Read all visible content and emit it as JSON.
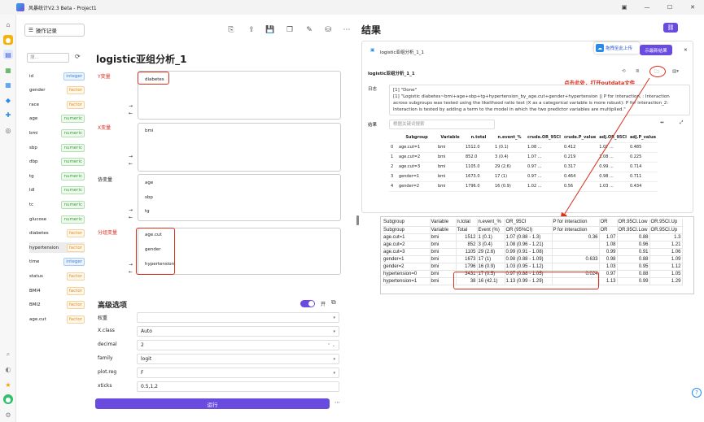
{
  "window": {
    "title": "风暴统计V2.3 Beta - Project1"
  },
  "toolbar": {
    "op_record": "操作记录"
  },
  "variables": {
    "search_placeholder": "搜...",
    "items": [
      {
        "name": "id",
        "type": "integer"
      },
      {
        "name": "gender",
        "type": "factor"
      },
      {
        "name": "race",
        "type": "factor"
      },
      {
        "name": "age",
        "type": "numeric"
      },
      {
        "name": "bmi",
        "type": "numeric"
      },
      {
        "name": "sbp",
        "type": "numeric"
      },
      {
        "name": "dbp",
        "type": "numeric"
      },
      {
        "name": "tg",
        "type": "numeric"
      },
      {
        "name": "ldl",
        "type": "numeric"
      },
      {
        "name": "tc",
        "type": "numeric"
      },
      {
        "name": "glucose",
        "type": "numeric"
      },
      {
        "name": "diabetes",
        "type": "factor"
      },
      {
        "name": "hypertension",
        "type": "factor"
      },
      {
        "name": "time",
        "type": "integer"
      },
      {
        "name": "status",
        "type": "factor"
      },
      {
        "name": "BMI4",
        "type": "factor"
      },
      {
        "name": "BMI2",
        "type": "factor"
      },
      {
        "name": "age.cut",
        "type": "factor"
      }
    ]
  },
  "analysis": {
    "title": "logistic亚组分析_1",
    "y_label": "Y变量",
    "y_items": [
      "diabetes"
    ],
    "x_label": "X变量",
    "x_items": [
      "bmi"
    ],
    "cov_label": "协变量",
    "cov_items": [
      "age",
      "sbp",
      "tg"
    ],
    "sub_label": "分组变量",
    "sub_items": [
      "age.cut",
      "gender",
      "hypertension"
    ]
  },
  "advanced": {
    "title": "高级选项",
    "toggle_label": "开",
    "fields": [
      {
        "label": "权重",
        "value": ""
      },
      {
        "label": "X.class",
        "value": "Auto"
      },
      {
        "label": "decimal",
        "value": "2"
      },
      {
        "label": "family",
        "value": "logit"
      },
      {
        "label": "plot.reg",
        "value": "F"
      },
      {
        "label": "xticks",
        "value": "0.5,1,2"
      }
    ],
    "run": "运行"
  },
  "results": {
    "title": "结果",
    "tab": "logistic亚组分析_1_1",
    "card_title": "logistic亚组分析_1_1",
    "popup": "拖拽至此上传",
    "show_latest": "示最新结果",
    "annotation": "点击此处，打开outdata文件",
    "log_label": "日志",
    "log_lines": [
      "[1] \"Done\"",
      "[1] \"Logistic diabetes~bmi+age+sbp+tg+hypertension_by_age.cut+gender+hypertension  ||  P for interaction, : Interaction",
      "across subgroups was tested using the likelihood ratio test (X as a categorical variable is more robust): P for interaction_2:",
      "Interaction is tested by adding a term to the model in which the two predictor variables are multiplied.\""
    ],
    "result_label": "结果",
    "search_placeholder": "根据关键词搜索",
    "table_headers": [
      "",
      "Subgroup",
      "Variable",
      "n.total",
      "n.event_%",
      "crude.OR_95CI",
      "crude.P_value",
      "adj.OR_95CI",
      "adj.P_value"
    ],
    "table_rows": [
      [
        "0",
        "age.cut=1",
        "bmi",
        "1512.0",
        "1 (0.1)",
        "1.08 ...",
        "0.412",
        "1.07 ...",
        "0.485"
      ],
      [
        "1",
        "age.cut=2",
        "bmi",
        "852.0",
        "3 (0.4)",
        "1.07 ...",
        "0.219",
        "1.08 ...",
        "0.225"
      ],
      [
        "2",
        "age.cut=3",
        "bmi",
        "1105.0",
        "29 (2.6)",
        "0.97 ...",
        "0.317",
        "0.99 ...",
        "0.714"
      ],
      [
        "3",
        "gender=1",
        "bmi",
        "1673.0",
        "17 (1)",
        "0.97 ...",
        "0.464",
        "0.98 ...",
        "0.711"
      ],
      [
        "4",
        "gender=2",
        "bmi",
        "1796.0",
        "16 (0.9)",
        "1.02 ...",
        "0.56",
        "1.03 ...",
        "0.434"
      ]
    ]
  },
  "outdata": {
    "rows": [
      [
        "Subgroup",
        "Variable",
        "n.total",
        "n.event_%",
        "OR_95CI",
        "P for interaction",
        "OR",
        "OR.95CI.Low",
        "OR.95CI.Up"
      ],
      [
        "Subgroup",
        "Variable",
        "Total",
        "Event (%)",
        "OR (95%CI)",
        "P for interaction",
        "OR",
        "OR.95CI.Low",
        "OR.95CI.Up"
      ],
      [
        "age.cut=1",
        "bmi",
        "1512",
        "1 (0.1)",
        "1.07 (0.88 - 1.3)",
        "0.36",
        "1.07",
        "0.88",
        "1.3"
      ],
      [
        "age.cut=2",
        "bmi",
        "852",
        "3 (0.4)",
        "1.08 (0.96 - 1.21)",
        "",
        "1.08",
        "0.96",
        "1.21"
      ],
      [
        "age.cut=3",
        "bmi",
        "1105",
        "29 (2.6)",
        "0.99 (0.91 - 1.08)",
        "",
        "0.99",
        "0.91",
        "1.06"
      ],
      [
        "gender=1",
        "bmi",
        "1673",
        "17 (1)",
        "0.98 (0.88 - 1.09)",
        "0.633",
        "0.98",
        "0.88",
        "1.09"
      ],
      [
        "gender=2",
        "bmi",
        "1796",
        "16 (0.9)",
        "1.03 (0.95 - 1.12)",
        "",
        "1.03",
        "0.95",
        "1.12"
      ],
      [
        "hypertension=0",
        "bmi",
        "3431",
        "17 (0.5)",
        "0.97 (0.88 - 1.05)",
        "0.024",
        "0.97",
        "0.88",
        "1.05"
      ],
      [
        "hypertension=1",
        "bmi",
        "38",
        "16 (42.1)",
        "1.13 (0.99 - 1.29)",
        "",
        "1.13",
        "0.99",
        "1.29"
      ]
    ]
  },
  "colors": {
    "accent": "#6a4be0",
    "annotation": "#d9301f"
  }
}
